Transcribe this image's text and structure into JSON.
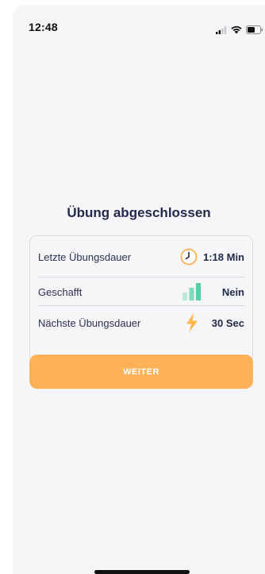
{
  "status_bar": {
    "time": "12:48",
    "icons": [
      "cellular-signal-icon",
      "wifi-icon",
      "battery-icon"
    ]
  },
  "title": "Übung abgeschlossen",
  "stats": [
    {
      "label": "Letzte Übungsdauer",
      "icon": "clock-icon",
      "value": "1:18 Min"
    },
    {
      "label": "Geschafft",
      "icon": "bar-chart-icon",
      "value": "Nein"
    },
    {
      "label": "Nächste Übungsdauer",
      "icon": "lightning-icon",
      "value": "30 Sec"
    }
  ],
  "button": {
    "label": "WEITER"
  },
  "colors": {
    "accent": "#ffb157",
    "title": "#22294a",
    "background": "#f6f6f8",
    "chart_green": "#54d1a4"
  }
}
